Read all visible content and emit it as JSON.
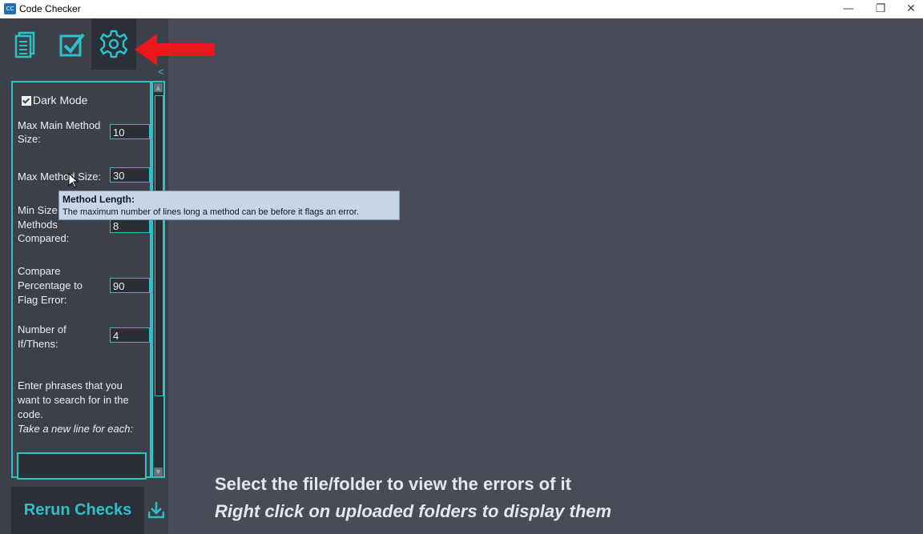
{
  "window": {
    "icon_text": "CC",
    "title": "Code Checker",
    "minimize_glyph": "—",
    "restore_glyph": "❐",
    "close_glyph": "✕"
  },
  "tabs": [
    {
      "name": "files",
      "icon": "document-icon",
      "active": false
    },
    {
      "name": "checks",
      "icon": "checkbox-icon",
      "active": false
    },
    {
      "name": "settings",
      "icon": "gear-icon",
      "active": true
    }
  ],
  "sidebar": {
    "collapse_glyph": "<"
  },
  "settings": {
    "dark_mode_label": "Dark Mode",
    "dark_mode_checked": true,
    "max_main_method_label_1": "Max Main Method",
    "max_main_method_label_2": "Size:",
    "max_main_method_value": "10",
    "max_method_label": "Max Method Size:",
    "max_method_value": "30",
    "min_size_label_1": "Min Size",
    "min_size_label_2": "Methods",
    "min_size_label_3": "Compared:",
    "min_size_value": "8",
    "compare_label_1": "Compare",
    "compare_label_2": "Percentage to",
    "compare_label_3": "Flag Error:",
    "compare_value": "90",
    "ifthens_label_1": "Number of",
    "ifthens_label_2": "If/Thens:",
    "ifthens_value": "4",
    "phrases_line_1": "Enter phrases that you",
    "phrases_line_2": "want to search for in the",
    "phrases_line_3": "code.",
    "phrases_hint": "Take a new line for each:"
  },
  "tooltip": {
    "title": "Method Length:",
    "body": "The maximum number of lines long a method can be before it flags an error."
  },
  "actions": {
    "rerun_label": "Rerun Checks",
    "download_icon": "download-icon"
  },
  "main": {
    "message_1": "Select the file/folder to view the errors of it",
    "message_2": "Right click on uploaded folders to display them"
  },
  "colors": {
    "accent": "#2bc1c7",
    "background": "#474c56",
    "sidebar": "#3b4049",
    "annotation_arrow": "#e8181c"
  }
}
